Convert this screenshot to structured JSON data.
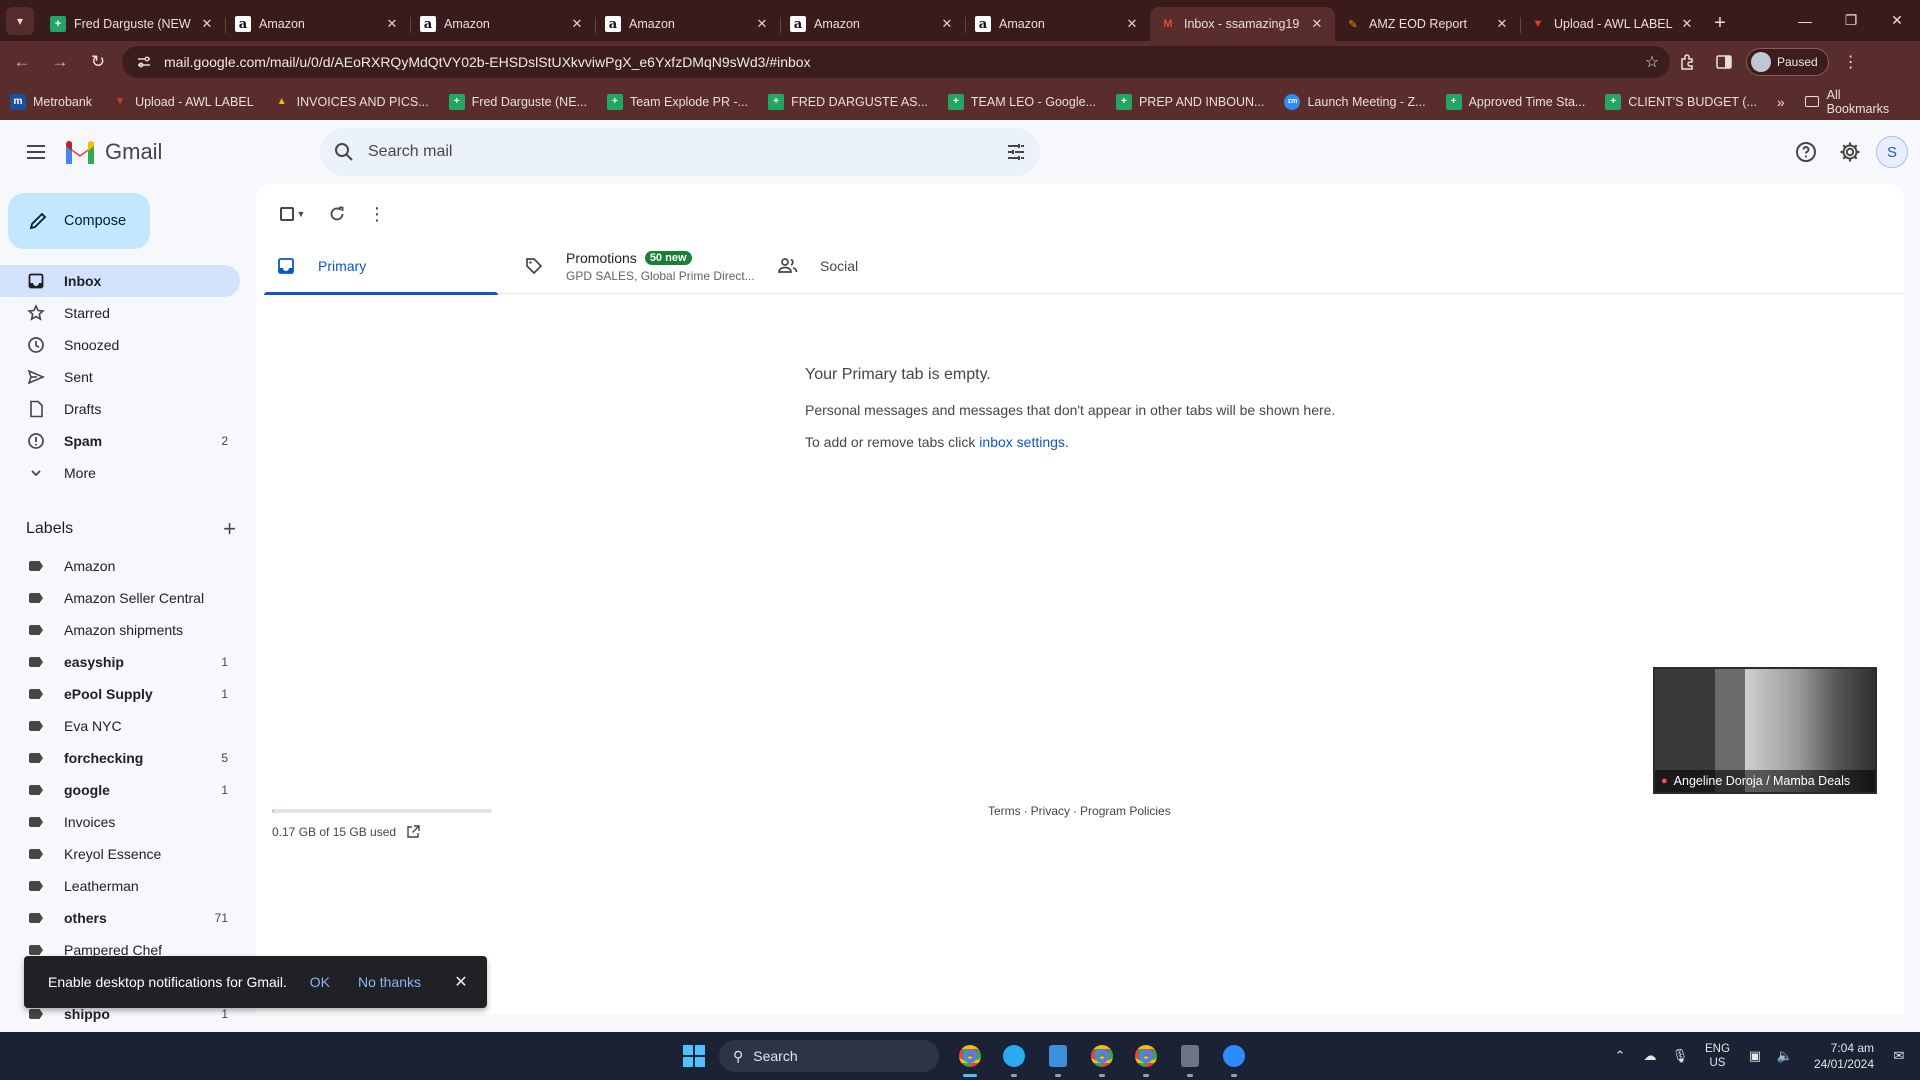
{
  "browser": {
    "tabs": [
      {
        "title": "Fred Darguste (NEW",
        "favicon": "sheets-icon",
        "active": false
      },
      {
        "title": "Amazon",
        "favicon": "amazon-icon",
        "active": false
      },
      {
        "title": "Amazon",
        "favicon": "amazon-icon",
        "active": false
      },
      {
        "title": "Amazon",
        "favicon": "amazon-icon",
        "active": false
      },
      {
        "title": "Amazon",
        "favicon": "amazon-icon",
        "active": false
      },
      {
        "title": "Amazon",
        "favicon": "amazon-icon",
        "active": false
      },
      {
        "title": "Inbox - ssamazing19",
        "favicon": "gmail-icon",
        "active": true
      },
      {
        "title": "AMZ EOD Report",
        "favicon": "pencil-icon",
        "active": false
      },
      {
        "title": "Upload - AWL LABEL",
        "favicon": "upload-icon",
        "active": false
      }
    ],
    "url": "mail.google.com/mail/u/0/d/AEoRXRQyMdQtVY02b-EHSDslStUXkvviwPgX_e6YxfzDMqN9sWd3/#inbox",
    "profile_status": "Paused",
    "bookmarks": [
      {
        "label": "Metrobank",
        "icon": "metrobank-icon"
      },
      {
        "label": "Upload - AWL LABEL",
        "icon": "upload-icon"
      },
      {
        "label": "INVOICES AND PICS...",
        "icon": "drive-icon"
      },
      {
        "label": "Fred Darguste (NE...",
        "icon": "sheets-icon"
      },
      {
        "label": "Team Explode PR -...",
        "icon": "sheets-icon"
      },
      {
        "label": "FRED DARGUSTE AS...",
        "icon": "sheets-icon"
      },
      {
        "label": "TEAM LEO - Google...",
        "icon": "sheets-icon"
      },
      {
        "label": "PREP AND INBOUN...",
        "icon": "sheets-icon"
      },
      {
        "label": "Launch Meeting - Z...",
        "icon": "zoom-icon"
      },
      {
        "label": "Approved Time Sta...",
        "icon": "sheets-icon"
      },
      {
        "label": "CLIENT'S BUDGET (...",
        "icon": "sheets-icon"
      }
    ],
    "all_bookmarks": "All Bookmarks"
  },
  "gmail": {
    "logo_text": "Gmail",
    "search_placeholder": "Search mail",
    "account_initial": "S",
    "compose_label": "Compose",
    "nav": [
      {
        "label": "Inbox",
        "icon": "inbox-icon",
        "count": "",
        "active": true,
        "bold": true
      },
      {
        "label": "Starred",
        "icon": "star-icon",
        "count": "",
        "active": false,
        "bold": false
      },
      {
        "label": "Snoozed",
        "icon": "clock-icon",
        "count": "",
        "active": false,
        "bold": false
      },
      {
        "label": "Sent",
        "icon": "send-icon",
        "count": "",
        "active": false,
        "bold": false
      },
      {
        "label": "Drafts",
        "icon": "draft-icon",
        "count": "",
        "active": false,
        "bold": false
      },
      {
        "label": "Spam",
        "icon": "spam-icon",
        "count": "2",
        "active": false,
        "bold": true
      },
      {
        "label": "More",
        "icon": "chevron-down-icon",
        "count": "",
        "active": false,
        "bold": false
      }
    ],
    "labels_heading": "Labels",
    "labels": [
      {
        "label": "Amazon",
        "count": "",
        "bold": false
      },
      {
        "label": "Amazon Seller Central",
        "count": "",
        "bold": false
      },
      {
        "label": "Amazon shipments",
        "count": "",
        "bold": false
      },
      {
        "label": "easyship",
        "count": "1",
        "bold": true
      },
      {
        "label": "ePool Supply",
        "count": "1",
        "bold": true
      },
      {
        "label": "Eva NYC",
        "count": "",
        "bold": false
      },
      {
        "label": "forchecking",
        "count": "5",
        "bold": true
      },
      {
        "label": "google",
        "count": "1",
        "bold": true
      },
      {
        "label": "Invoices",
        "count": "",
        "bold": false
      },
      {
        "label": "Kreyol Essence",
        "count": "",
        "bold": false
      },
      {
        "label": "Leatherman",
        "count": "",
        "bold": false
      },
      {
        "label": "others",
        "count": "71",
        "bold": true
      },
      {
        "label": "Pampered Chef",
        "count": "",
        "bold": false
      },
      {
        "label": "",
        "count": "",
        "bold": false
      },
      {
        "label": "shippo",
        "count": "1",
        "bold": true
      }
    ],
    "tabs": {
      "primary": "Primary",
      "promotions": "Promotions",
      "promotions_badge": "50 new",
      "promotions_sub": "GPD SALES, Global Prime Direct...",
      "social": "Social"
    },
    "empty": {
      "title": "Your Primary tab is empty.",
      "line1": "Personal messages and messages that don't appear in other tabs will be shown here.",
      "line2_prefix": "To add or remove tabs click ",
      "line2_link": "inbox settings",
      "line2_suffix": "."
    },
    "storage": {
      "text": "0.17 GB of 15 GB used",
      "fraction": 0.011
    },
    "footer": {
      "terms": "Terms",
      "privacy": "Privacy",
      "policies": "Program Policies"
    },
    "video_tile_name": "Angeline Doroja / Mamba Deals",
    "snackbar": {
      "text": "Enable desktop notifications for Gmail.",
      "ok": "OK",
      "no": "No thanks"
    }
  },
  "taskbar": {
    "search_label": "Search",
    "apps": [
      "chrome-icon",
      "telegram-icon",
      "notepad-icon",
      "chrome-icon",
      "chrome-icon",
      "calculator-icon",
      "zoom-icon"
    ],
    "lang_top": "ENG",
    "lang_bottom": "US",
    "time": "7:04 am",
    "date": "24/01/2024"
  },
  "colors": {
    "browser_frame": "#5a2d2d",
    "gmail_accent": "#0b57d0",
    "compose_bg": "#c2e7ff",
    "inbox_active_bg": "#d3e3fd",
    "badge_green": "#188038"
  }
}
